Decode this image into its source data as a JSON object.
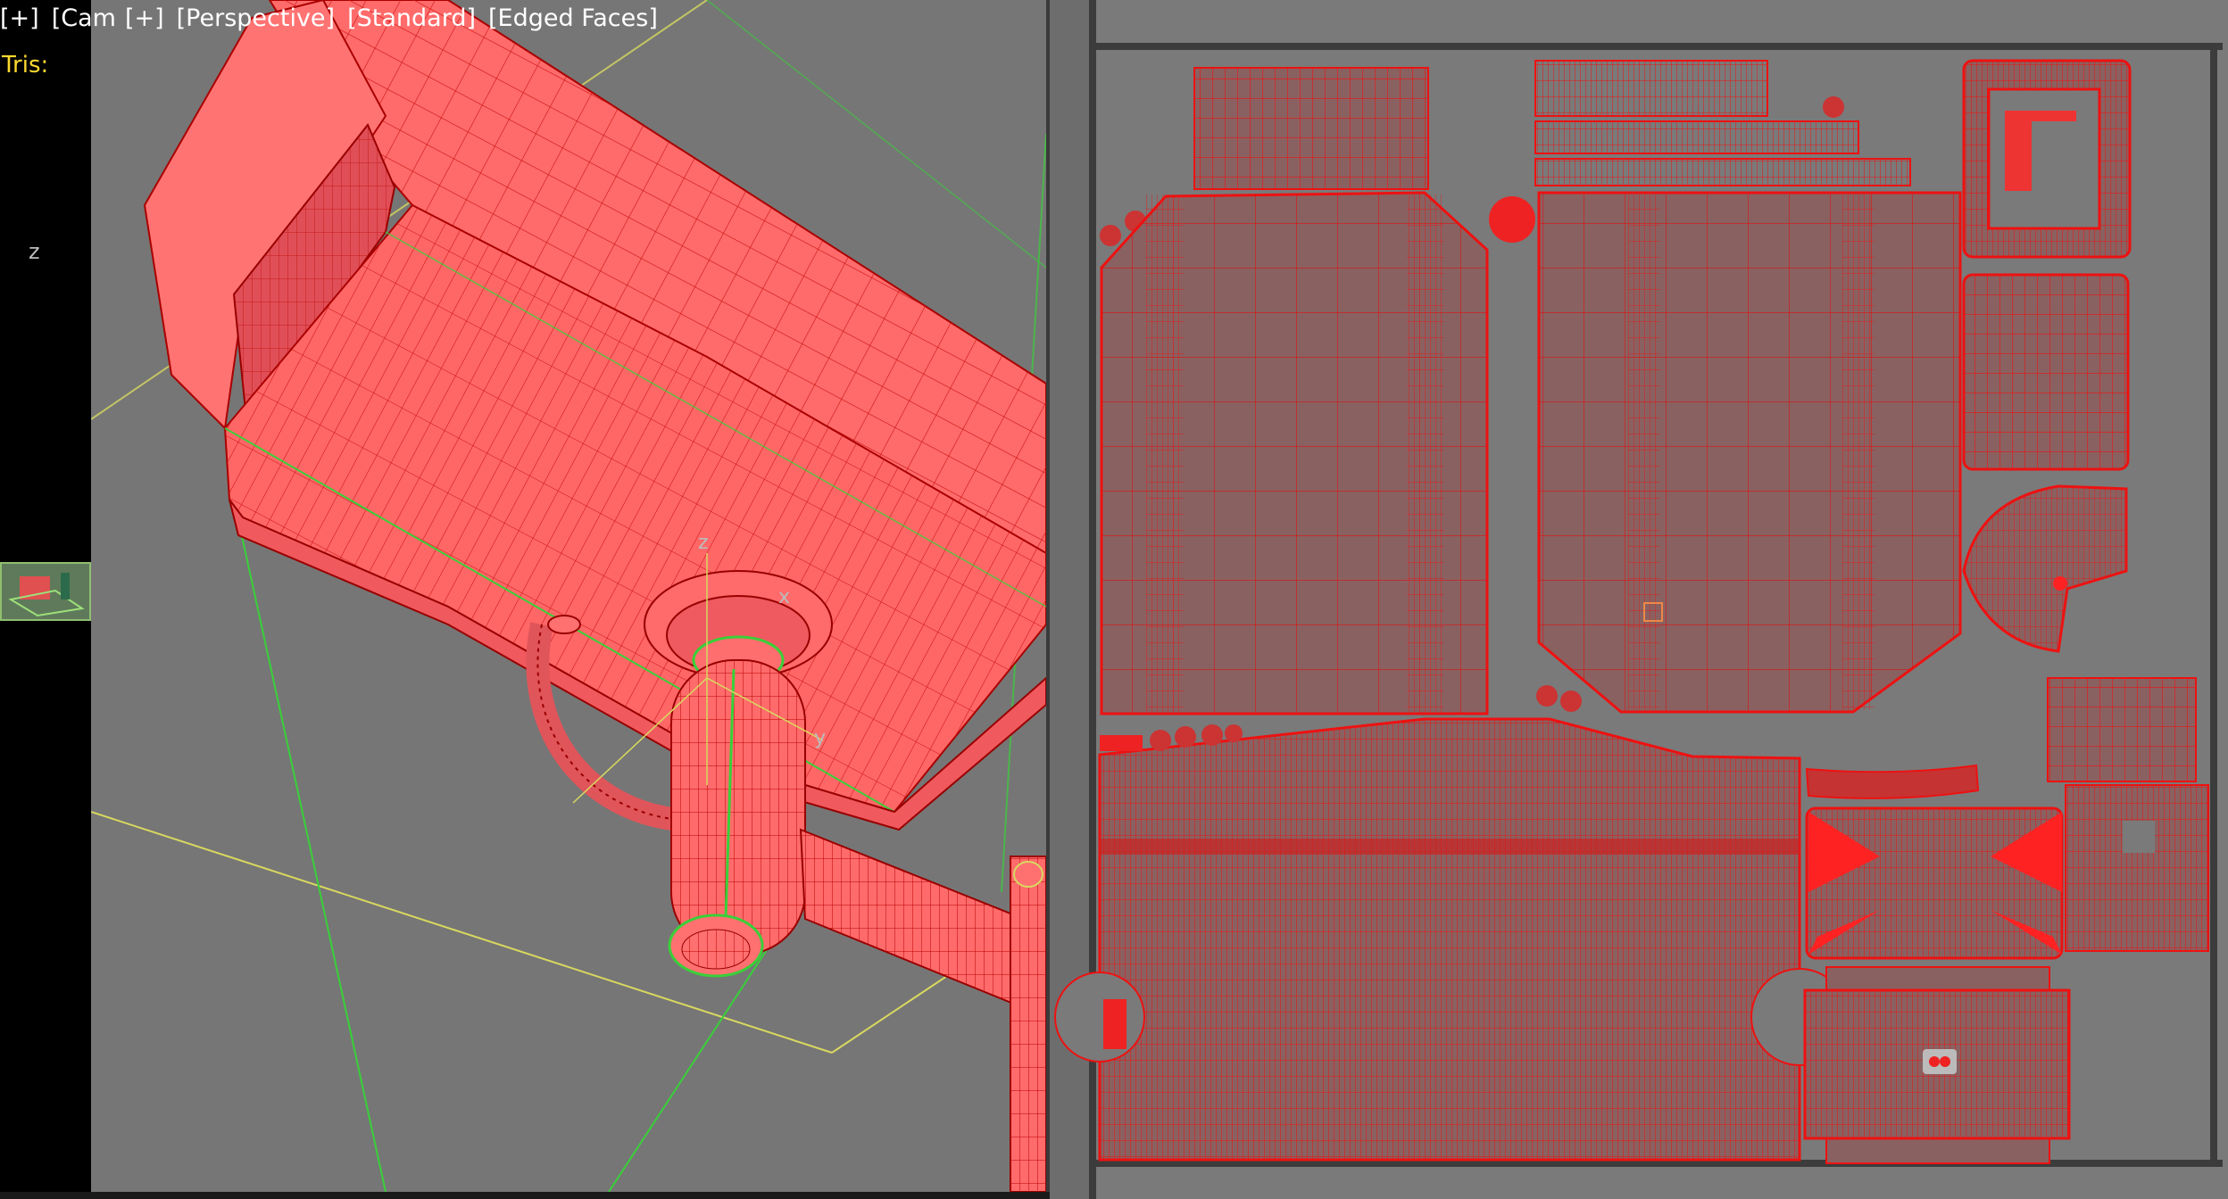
{
  "viewport": {
    "labels": [
      "[+]",
      "[Cam",
      "[+]",
      "[Perspective]",
      "[Standard]",
      "[Edged Faces]"
    ],
    "tris_label": "Tris:",
    "axis_label_z": "z",
    "gizmo_x": "x",
    "gizmo_y": "y",
    "gizmo_z": "z"
  },
  "colors": {
    "mesh_fill": "#ff6b6b",
    "wire": "#cc1111",
    "uv_shell_fill": "#8a5f5f",
    "uv_wire": "#ee1111",
    "viewport_bg": "#767676",
    "uv_bg": "#7a7a7a",
    "gizmo_green": "#39d039",
    "gizmo_yellow": "#d8d860",
    "label_yellow": "#ffd92e"
  },
  "icons": [
    "navigation-thumbnail-icon"
  ]
}
